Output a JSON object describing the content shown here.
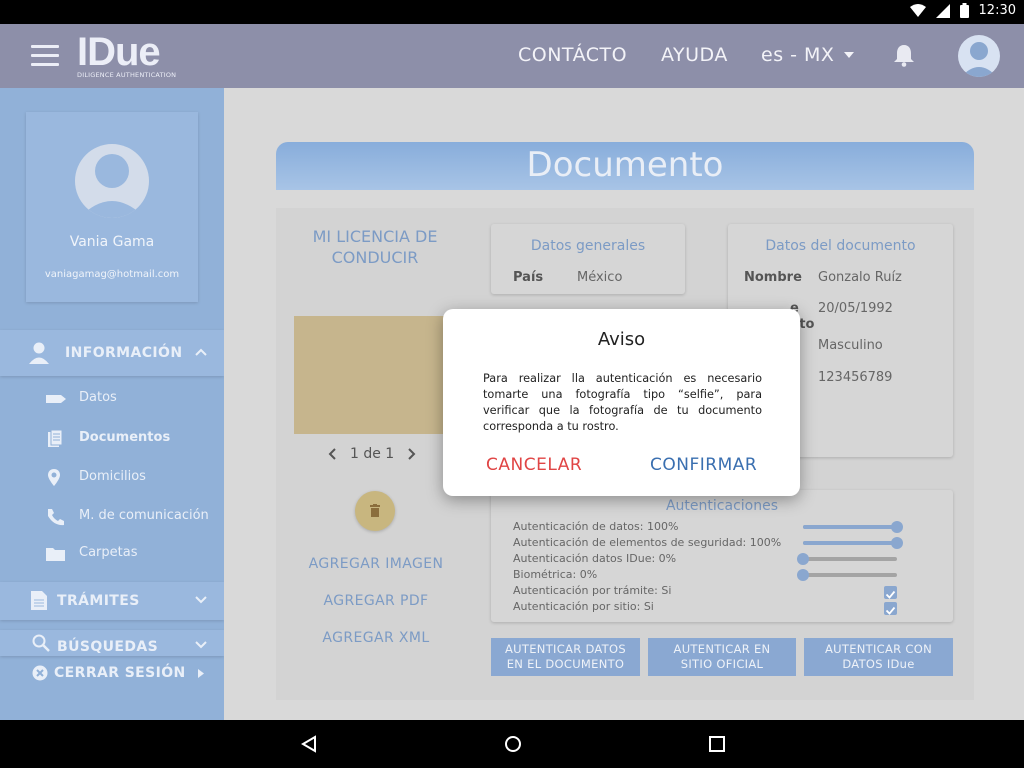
{
  "status_bar": {
    "time": "12:30"
  },
  "header": {
    "logo_text": "IDue",
    "logo_subtitle": "DILIGENCE AUTHENTICATION",
    "nav_contact": "CONTÁCTO",
    "nav_help": "AYUDA",
    "language": "es - MX"
  },
  "sidebar": {
    "user_name": "Vania Gama",
    "user_email": "vaniagamag@hotmail.com",
    "section_info": "INFORMACIÓN",
    "items": [
      {
        "label": "Datos",
        "icon": "tag-icon"
      },
      {
        "label": "Documentos",
        "icon": "documents-icon"
      },
      {
        "label": "Domicilios",
        "icon": "location-pin-icon"
      },
      {
        "label": "M. de comunicación",
        "icon": "phone-icon"
      },
      {
        "label": "Carpetas",
        "icon": "folder-icon"
      }
    ],
    "section_tramites": "TRÁMITES",
    "section_busquedas": "BÚSQUEDAS",
    "logout": "CERRAR SESIÓN"
  },
  "main": {
    "title": "Documento",
    "doc_type": "MI LICENCIA DE CONDUCIR",
    "pager": "1 de 1",
    "add_image": "AGREGAR IMAGEN",
    "add_pdf": "AGREGAR PDF",
    "add_xml": "AGREGAR XML",
    "general": {
      "title": "Datos generales",
      "country_label": "País",
      "country_value": "México"
    },
    "document": {
      "title": "Datos del documento",
      "name_label": "Nombre",
      "name_value": "Gonzalo Ruíz",
      "partial_label_1": "e",
      "partial_label_2": "nto",
      "birth_value": "20/05/1992",
      "gender_value": "Masculino",
      "number_value": "123456789"
    },
    "auth": {
      "title": "Autenticaciones",
      "rows": [
        {
          "label": "Autenticación de datos: 100%",
          "progress": 1.0
        },
        {
          "label": "Autenticación de elementos de seguridad: 100%",
          "progress": 1.0
        },
        {
          "label": "Autenticación datos IDue: 0%",
          "progress": 0.0
        },
        {
          "label": "Biométrica: 0%",
          "progress": 0.0
        },
        {
          "label": "Autenticación por trámite: Si",
          "checked": true
        },
        {
          "label": "Autenticación por sitio: Si",
          "checked": true
        }
      ]
    },
    "actions": {
      "btn1_line1": "AUTENTICAR DATOS",
      "btn1_line2": "EN EL DOCUMENTO",
      "btn2_line1": "AUTENTICAR EN",
      "btn2_line2": "SITIO OFICIAL",
      "btn3_line1": "AUTENTICAR CON",
      "btn3_line2": "DATOS IDue"
    }
  },
  "modal": {
    "title": "Aviso",
    "body": "Para realizar lla autenticación es necesario tomarte una fotografía tipo “selfie”, para verificar que la fotografía de tu documento corresponda a tu rostro.",
    "cancel": "CANCELAR",
    "confirm": "CONFIRMAR",
    "cancel_color": "#e04545",
    "confirm_color": "#3a6fb0"
  }
}
